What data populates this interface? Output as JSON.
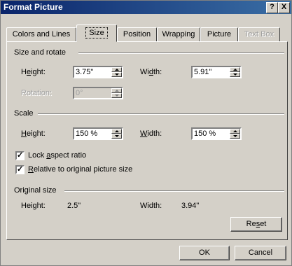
{
  "window": {
    "title": "Format Picture",
    "help_label": "?",
    "close_label": "X"
  },
  "tabs": [
    {
      "label": "Colors and Lines",
      "active": false,
      "disabled": false
    },
    {
      "label": "Size",
      "active": true,
      "disabled": false
    },
    {
      "label": "Position",
      "active": false,
      "disabled": false
    },
    {
      "label": "Wrapping",
      "active": false,
      "disabled": false
    },
    {
      "label": "Picture",
      "active": false,
      "disabled": false
    },
    {
      "label": "Text Box",
      "active": false,
      "disabled": true
    }
  ],
  "size_rotate": {
    "section_label": "Size and rotate",
    "height_label_pre": "H",
    "height_label_u": "e",
    "height_label_post": "ight:",
    "height_value": "3.75\"",
    "width_label_pre": "Wi",
    "width_label_u": "d",
    "width_label_post": "th:",
    "width_value": "5.91\"",
    "rotation_label": "Rotation:",
    "rotation_value": "0°"
  },
  "scale": {
    "section_label": "Scale",
    "height_label_u": "H",
    "height_label_post": "eight:",
    "height_value": "150 %",
    "width_label_u": "W",
    "width_label_post": "idth:",
    "width_value": "150 %",
    "lock_pre": "Lock ",
    "lock_u": "a",
    "lock_post": "spect ratio",
    "lock_checked": "✓",
    "relative_u": "R",
    "relative_post": "elative to original picture size",
    "relative_checked": "✓"
  },
  "original_size": {
    "section_label": "Original size",
    "height_label": "Height:",
    "height_value": "2.5\"",
    "width_label": "Width:",
    "width_value": "3.94\"",
    "reset_pre": "Re",
    "reset_u": "s",
    "reset_post": "et"
  },
  "buttons": {
    "ok_label": "OK",
    "cancel_label": "Cancel"
  }
}
